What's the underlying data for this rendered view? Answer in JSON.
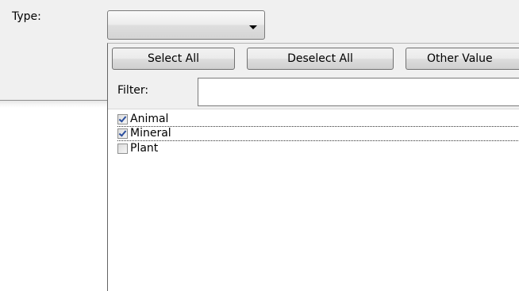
{
  "form": {
    "type_label": "Type:"
  },
  "combo": {
    "value": "",
    "arrow_icon": "dropdown-arrow-icon"
  },
  "toolbar": {
    "select_all_label": "Select All",
    "deselect_all_label": "Deselect All",
    "other_value_label": "Other Value"
  },
  "filter": {
    "label": "Filter:",
    "value": ""
  },
  "items": [
    {
      "label": "Animal",
      "checked": true
    },
    {
      "label": "Mineral",
      "checked": true
    },
    {
      "label": "Plant",
      "checked": false
    }
  ],
  "colors": {
    "check_mark": "#2b4f9e",
    "panel_background": "#f0f0f0"
  }
}
